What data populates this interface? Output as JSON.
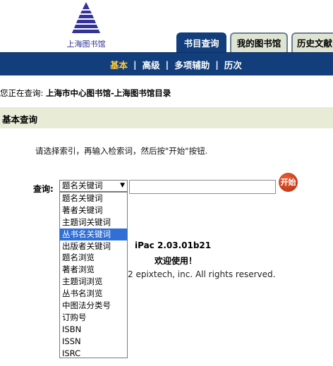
{
  "logo": {
    "text": "上海图书馆",
    "color": "#333399"
  },
  "tabs": [
    {
      "label": "书目查询",
      "active": true
    },
    {
      "label": "我的图书馆",
      "active": false
    },
    {
      "label": "历史文献",
      "active": false
    }
  ],
  "nav": {
    "items": [
      {
        "label": "基本",
        "active": true
      },
      {
        "label": "高级"
      },
      {
        "label": "多项辅助"
      },
      {
        "label": "历次"
      }
    ],
    "separator": "|"
  },
  "location": {
    "prefix": "您正在查询: ",
    "database": "上海市中心图书馆-上海图书馆目录"
  },
  "section": {
    "title": "基本查询"
  },
  "instruction": "请选择索引，再输入检索词，然后按\"开始\"按钮.",
  "query": {
    "label": "查询:",
    "selected": "题名关键词",
    "input_value": "",
    "go_label": "开始"
  },
  "dropdown": {
    "options": [
      "题名关键词",
      "著者关键词",
      "主题词关键词",
      "丛书名关键词",
      "出版者关键词",
      "题名浏览",
      "著者浏览",
      "主题词浏览",
      "丛书名浏览",
      "中图法分类号",
      "订购号",
      "ISBN",
      "ISSN",
      "ISRC"
    ],
    "highlighted": 3
  },
  "footer": {
    "version": "iPac 2.03.01b21",
    "welcome": "欢迎使用！",
    "copyright": "2 epixtech, inc. All rights reserved."
  },
  "colors": {
    "nav_bg": "#123f7c",
    "section_bg": "#e8ecd6",
    "tab_bg": "#dfe4d2",
    "nav_active": "#ffcc33",
    "highlight": "#2f6fd6",
    "go_button": "#c8391a"
  }
}
